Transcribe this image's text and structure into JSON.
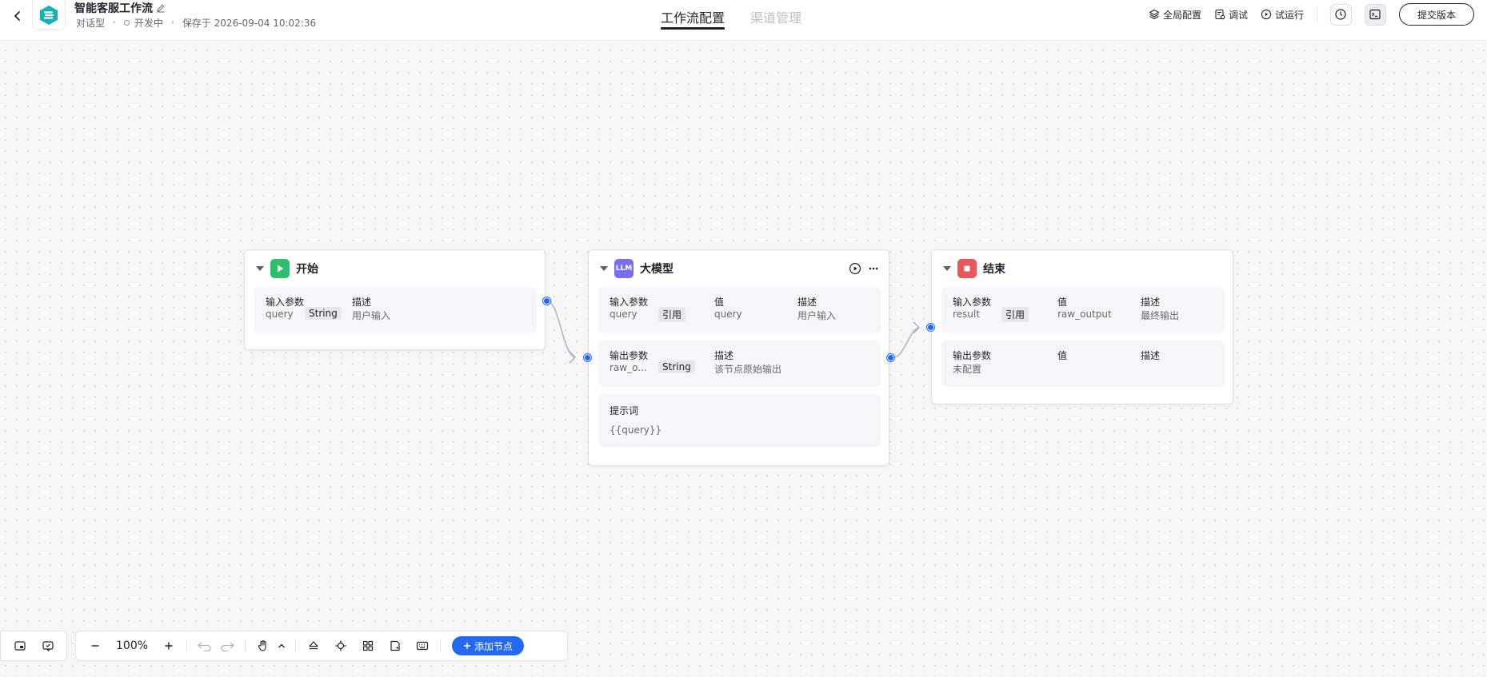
{
  "header": {
    "app_title": "智能客服工作流",
    "meta_type": "对话型",
    "meta_status": "开发中",
    "meta_saved": "保存于 2026-09-04 10:02:36",
    "tabs": [
      {
        "label": "工作流配置",
        "active": true
      },
      {
        "label": "渠道管理",
        "active": false
      }
    ],
    "actions": {
      "global_config": "全局配置",
      "debug": "调试",
      "trial_run": "试运行",
      "submit": "提交版本"
    }
  },
  "nodes": {
    "start": {
      "title": "开始",
      "input": {
        "label": "输入参数",
        "desc_label": "描述",
        "name": "query",
        "type": "String",
        "desc": "用户输入"
      }
    },
    "llm": {
      "title": "大模型",
      "icon_text": "LLM",
      "input": {
        "label": "输入参数",
        "value_label": "值",
        "desc_label": "描述",
        "name": "query",
        "tag": "引用",
        "value": "query",
        "desc": "用户输入"
      },
      "output": {
        "label": "输出参数",
        "desc_label": "描述",
        "name": "raw_o...",
        "type": "String",
        "desc": "该节点原始输出"
      },
      "prompt": {
        "label": "提示词",
        "content": "{{query}}"
      }
    },
    "end": {
      "title": "结束",
      "input": {
        "label": "输入参数",
        "value_label": "值",
        "desc_label": "描述",
        "name": "result",
        "tag": "引用",
        "value": "raw_output",
        "desc": "最终输出"
      },
      "output": {
        "label": "输出参数",
        "value_label": "值",
        "desc_label": "描述",
        "empty": "未配置"
      }
    }
  },
  "toolbar": {
    "zoom": "100%",
    "add_node": "添加节点"
  },
  "colors": {
    "accent": "#2468f2",
    "start_icon": "#2fbf6b",
    "llm_icon": "#7b6cf0",
    "end_icon": "#e8575a",
    "logo": "#11b3b3"
  }
}
